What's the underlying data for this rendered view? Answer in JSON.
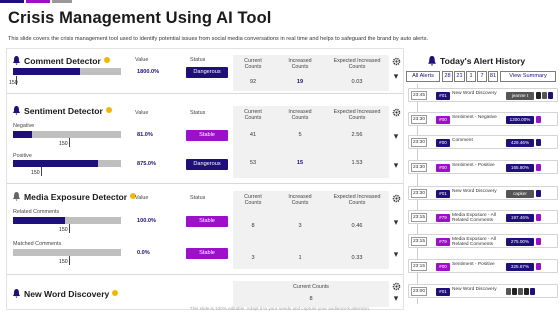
{
  "page": {
    "title": "Crisis Management Using AI Tool",
    "subtitle": "This slide covers the crisis management tool used to identify potential issues from social media conversations in real time and helps to safeguard the brand by auto alerts.",
    "footer": "This slide is 100% editable. Adapt it to your needs and capture your audience's attention."
  },
  "colors": {
    "dark": "#1e0f7a",
    "purple": "#9b10c8",
    "grey": "#bfbfbf"
  },
  "comment": {
    "title": "Comment Detector",
    "icon": "bell-icon",
    "value_header": "Value",
    "status_header": "Status",
    "value": "1800.0%",
    "status": "Dangerous",
    "scale": "150",
    "level": 0.62,
    "table": {
      "headers": [
        "Current Counts",
        "Increased Counts",
        "Expected Increased Counts"
      ],
      "row": [
        "92",
        "19",
        "0.03"
      ]
    }
  },
  "sentiment": {
    "title": "Sentiment Detector",
    "icon": "bell-icon",
    "value_header": "Value",
    "status_header": "Status",
    "rows": [
      {
        "label": "Negative",
        "value": "81.0%",
        "status": "Stable",
        "scale": "150",
        "level": 0.18
      },
      {
        "label": "Positive",
        "value": "875.0%",
        "status": "Dangerous",
        "scale": "150",
        "level": 0.79
      }
    ],
    "table": {
      "headers": [
        "Current Counts",
        "Increased Counts",
        "Expected Increased Counts"
      ],
      "rows": [
        [
          "41",
          "5",
          "2.56"
        ],
        [
          "53",
          "15",
          "1.53"
        ]
      ]
    }
  },
  "media": {
    "title": "Media Exposure Detector",
    "icon": "bell-icon",
    "value_header": "Value",
    "status_header": "Status",
    "rows": [
      {
        "label": "Related Comments",
        "value": "100.0%",
        "status": "Stable",
        "scale": "150",
        "level": 0.48
      },
      {
        "label": "Matched Comments",
        "value": "0.0%",
        "status": "Stable",
        "scale": "150",
        "level": 0.0
      }
    ],
    "table": {
      "headers": [
        "Current Counts",
        "Increased Counts",
        "Expected Increased Counts"
      ],
      "rows": [
        [
          "8",
          "3",
          "0.46"
        ],
        [
          "3",
          "1",
          "0.33"
        ]
      ]
    }
  },
  "newword": {
    "title": "New Word Discovery",
    "icon": "bell-icon",
    "table": {
      "header": "Current Counts",
      "value": "8"
    }
  },
  "alerts": {
    "title": "Today's Alert History",
    "filters": [
      "All Alerts",
      "28",
      "21",
      "1",
      "7",
      "81",
      "View Summary"
    ],
    "items": [
      {
        "time": "23:45",
        "id": "#01",
        "desc": "New Word Discovery",
        "pill": "jeanne t",
        "pill_color": "#555555",
        "squares": [
          "#222222",
          "#555555",
          "#1e0f7a"
        ],
        "id_color": "#1e0f7a"
      },
      {
        "time": "23:30",
        "id": "#00",
        "desc": "Sentiment - Negative",
        "pill": "1200.00%",
        "pill_color": "#1e0f7a",
        "squares": [
          "#9b10c8"
        ],
        "id_color": "#9b10c8"
      },
      {
        "time": "23:30",
        "id": "#00",
        "desc": "Comment",
        "pill": "429.46%",
        "pill_color": "#1e0f7a",
        "squares": [
          "#1e0f7a"
        ],
        "id_color": "#1e0f7a"
      },
      {
        "time": "23:30",
        "id": "#00",
        "desc": "Sentiment - Positive",
        "pill": "165.80%",
        "pill_color": "#1e0f7a",
        "squares": [
          "#9b10c8"
        ],
        "id_color": "#9b10c8"
      },
      {
        "time": "23:30",
        "id": "#01",
        "desc": "New Word Discovery",
        "pill": "capker",
        "pill_color": "#555555",
        "squares": [
          "#1e0f7a"
        ],
        "id_color": "#1e0f7a"
      },
      {
        "time": "23:15",
        "id": "#79",
        "desc": "Media Exposure - All Related Comments",
        "pill": "197.46%",
        "pill_color": "#1e0f7a",
        "squares": [
          "#9b10c8"
        ],
        "id_color": "#9b10c8"
      },
      {
        "time": "23:15",
        "id": "#79",
        "desc": "Media Exposure - All Related Comments",
        "pill": "275.00%",
        "pill_color": "#1e0f7a",
        "squares": [
          "#9b10c8"
        ],
        "id_color": "#9b10c8"
      },
      {
        "time": "23:15",
        "id": "#00",
        "desc": "Sentiment - Positive",
        "pill": "325.67%",
        "pill_color": "#1e0f7a",
        "squares": [
          "#9b10c8"
        ],
        "id_color": "#9b10c8"
      },
      {
        "time": "23:00",
        "id": "#01",
        "desc": "New Word Discovery",
        "pill": "",
        "pill_color": "#555555",
        "squares": [
          "#555555",
          "#222222",
          "#555555",
          "#222222",
          "#1e0f7a"
        ],
        "id_color": "#1e0f7a"
      }
    ]
  }
}
